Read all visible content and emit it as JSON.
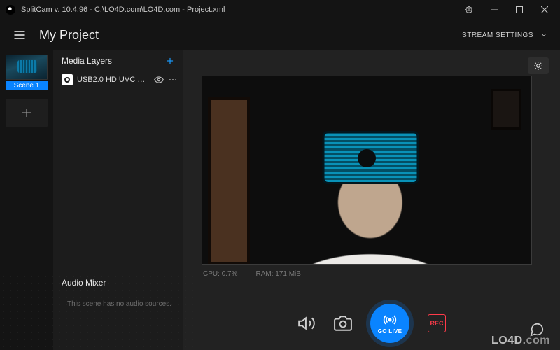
{
  "titlebar": {
    "text": "SplitCam v. 10.4.96 - C:\\LO4D.com\\LO4D.com - Project.xml"
  },
  "header": {
    "project_title": "My Project",
    "stream_settings_label": "STREAM SETTINGS"
  },
  "scenes": {
    "items": [
      {
        "label": "Scene 1"
      }
    ]
  },
  "sidebar": {
    "media_layers_title": "Media Layers",
    "layers": [
      {
        "name": "USB2.0 HD UVC WebC..."
      }
    ],
    "audio_mixer_title": "Audio Mixer",
    "audio_empty_text": "This scene has no audio sources."
  },
  "preview": {
    "stats": {
      "cpu_label": "CPU:",
      "cpu_value": "0.7%",
      "ram_label": "RAM:",
      "ram_value": "171 MiB"
    }
  },
  "controls": {
    "golive_label": "GO LIVE",
    "rec_label": "REC"
  },
  "watermark": {
    "brand": "LO4D",
    "suffix": ".com"
  }
}
